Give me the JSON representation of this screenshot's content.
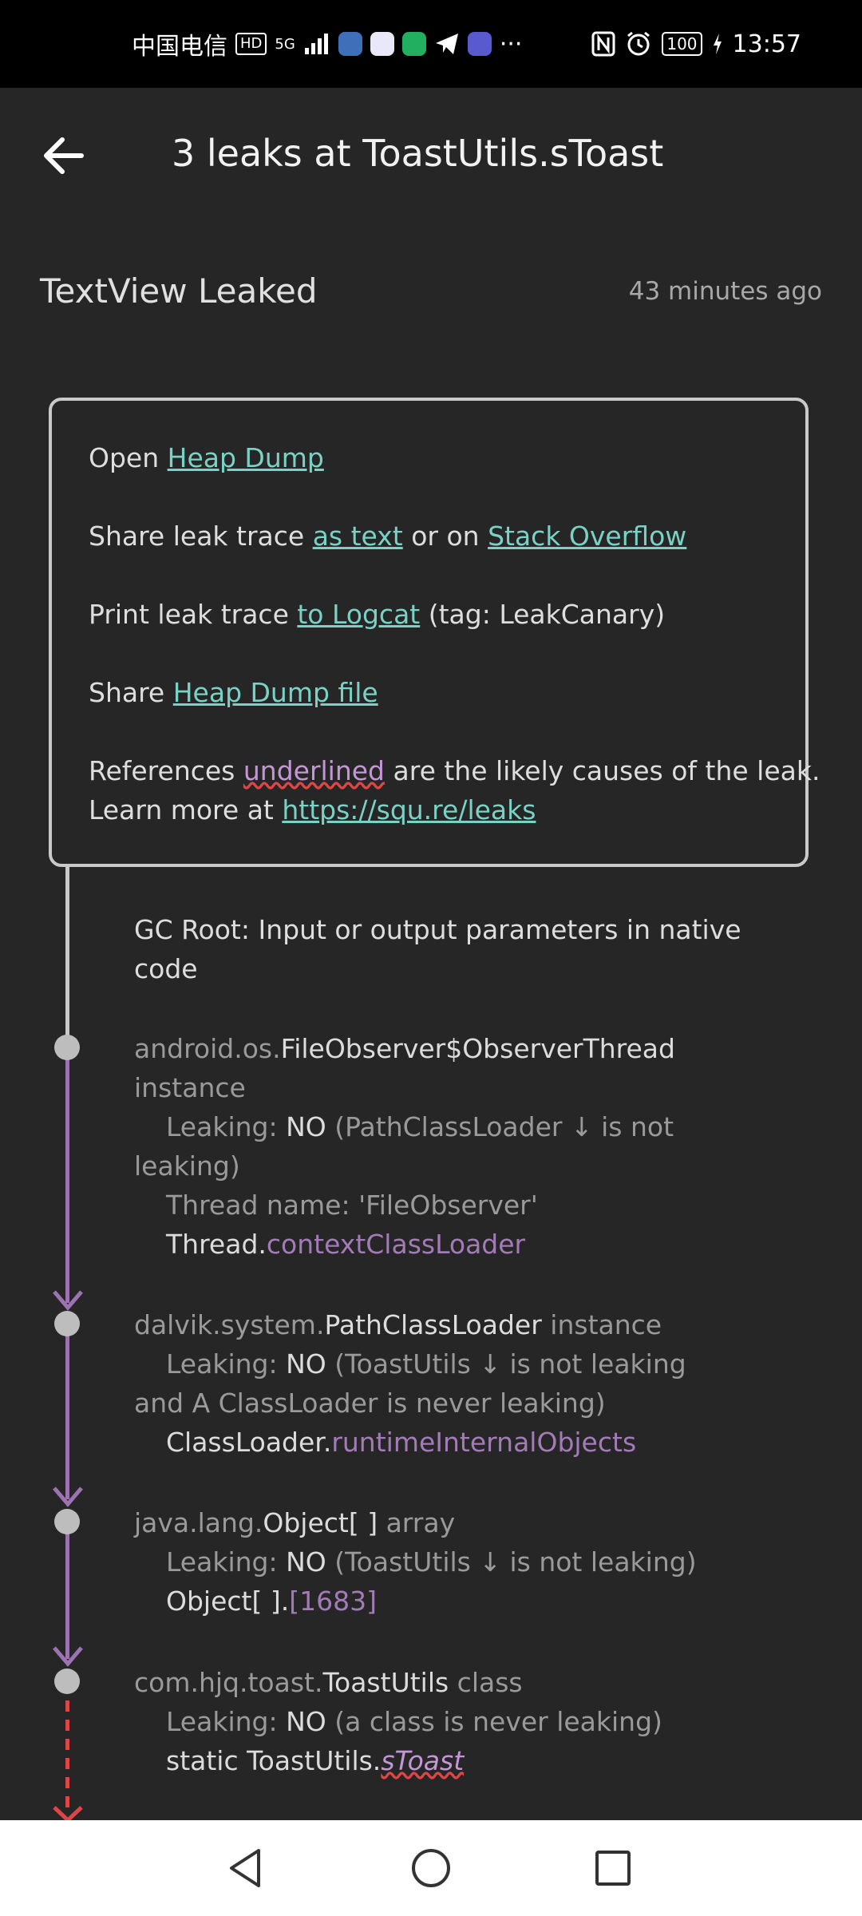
{
  "status_bar": {
    "carrier": "中国电信",
    "hd_badge": "HD",
    "network": "5G",
    "more": "···",
    "battery": "100",
    "time": "13:57"
  },
  "header": {
    "title": "3 leaks at ToastUtils.sToast"
  },
  "leak": {
    "name": "TextView Leaked",
    "time_ago": "43 minutes ago"
  },
  "info": {
    "open_prefix": "Open ",
    "heap_dump_link": "Heap Dump",
    "share_prefix": "Share leak trace ",
    "as_text_link": "as text",
    "or_on": " or on ",
    "stack_overflow_link": "Stack Overflow",
    "print_prefix": "Print leak trace ",
    "logcat_link": "to Logcat",
    "print_suffix": " (tag: LeakCanary)",
    "share_file_prefix": "Share ",
    "heap_dump_file_link": "Heap Dump file",
    "refs_prefix": "References ",
    "underlined_word": "underlined",
    "refs_suffix": " are the likely causes of the leak.",
    "learn_prefix": "Learn more at ",
    "learn_link": "https://squ.re/leaks"
  },
  "trace": {
    "gc_root_line1": "GC Root: Input or output parameters in native",
    "gc_root_line2": "code",
    "n1_pkg": "android.os.",
    "n1_class": "FileObserver$ObserverThread",
    "n1_kind": "instance",
    "n1_leak_label": "Leaking: ",
    "n1_leak_no": "NO",
    "n1_leak_reason_a": " (PathClassLoader ↓  is not",
    "n1_leak_reason_b": "leaking)",
    "n1_thread_name": "Thread name: 'FileObserver'",
    "n1_ref_owner": "Thread.",
    "n1_ref_field": "contextClassLoader",
    "n2_pkg": "dalvik.system.",
    "n2_class": "PathClassLoader",
    "n2_kind": " instance",
    "n2_leak_label": "Leaking: ",
    "n2_leak_no": "NO",
    "n2_leak_reason_a": " (ToastUtils ↓  is not leaking",
    "n2_leak_reason_b": "and A ClassLoader is never leaking)",
    "n2_ref_owner": "ClassLoader.",
    "n2_ref_field": "runtimeInternalObjects",
    "n3_pkg": "java.lang.",
    "n3_class": "Object[ ]",
    "n3_kind": " array",
    "n3_leak_label": "Leaking: ",
    "n3_leak_no": "NO",
    "n3_leak_reason": " (ToastUtils ↓  is not leaking)",
    "n3_ref_owner": "Object[ ].",
    "n3_ref_field": "[1683]",
    "n4_pkg": "com.hjq.toast.",
    "n4_class": "ToastUtils",
    "n4_kind": " class",
    "n4_leak_label": "Leaking: ",
    "n4_leak_no": "NO",
    "n4_leak_reason": " (a class is never leaking)",
    "n4_ref_owner": "static ToastUtils.",
    "n4_ref_field": "sToast"
  },
  "colors": {
    "background": "#262627",
    "link": "#79d2c4",
    "reference": "#a37bb6",
    "timeline": "#9d72b0",
    "suspect": "#e04545"
  }
}
